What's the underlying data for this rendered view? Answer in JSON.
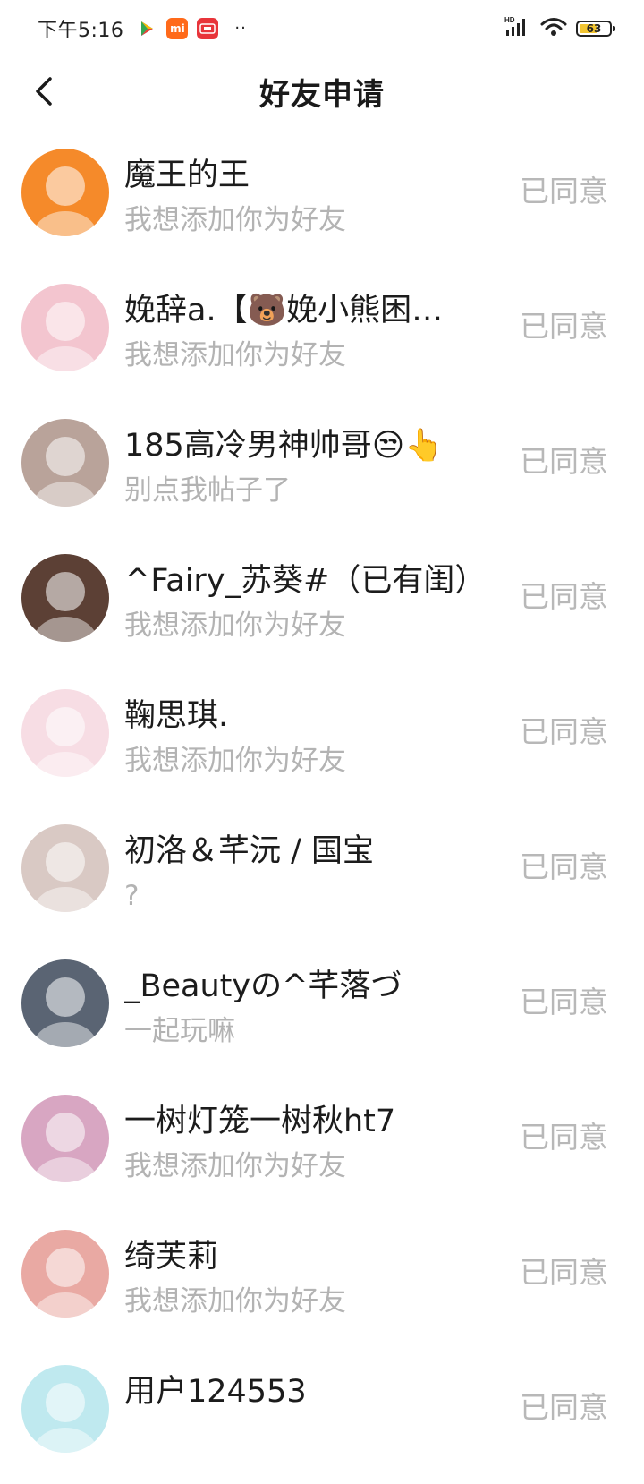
{
  "status_bar": {
    "time": "下午5:16",
    "app_icons": [
      "play-store-icon",
      "mi-icon",
      "red-app-icon"
    ],
    "dots": "··",
    "network": "HD",
    "battery": 63
  },
  "header": {
    "title": "好友申请",
    "back_icon": "chevron-left-icon"
  },
  "requests": [
    {
      "name": "魔王的王",
      "message": "我想添加你为好友",
      "status": "已同意",
      "avatar_color": "#f58a2a"
    },
    {
      "name": "娩辞a.【🐻娩小熊困…",
      "message": "我想添加你为好友",
      "status": "已同意",
      "avatar_color": "#f3c5cf"
    },
    {
      "name": "185高冷男神帅哥😒👆",
      "message": "别点我帖子了",
      "status": "已同意",
      "avatar_color": "#b9a39a"
    },
    {
      "name": "^Fairy_苏葵#（已有闺）",
      "message": "我想添加你为好友",
      "status": "已同意",
      "avatar_color": "#5c4035"
    },
    {
      "name": "鞠思琪.",
      "message": "我想添加你为好友",
      "status": "已同意",
      "avatar_color": "#f7dde4"
    },
    {
      "name": "初洛＆芊沅 / 国宝",
      "message": "?",
      "status": "已同意",
      "avatar_color": "#d9c9c4"
    },
    {
      "name": "_Beautyの^芊落づ",
      "message": "一起玩嘛",
      "status": "已同意",
      "avatar_color": "#5a6473"
    },
    {
      "name": "一树灯笼一树秋ht7",
      "message": "我想添加你为好友",
      "status": "已同意",
      "avatar_color": "#d8a6c2"
    },
    {
      "name": "绮芙莉",
      "message": "我想添加你为好友",
      "status": "已同意",
      "avatar_color": "#e9a9a3"
    },
    {
      "name": "用户124553",
      "message": "",
      "status": "已同意",
      "avatar_color": "#bfe9ef"
    }
  ]
}
